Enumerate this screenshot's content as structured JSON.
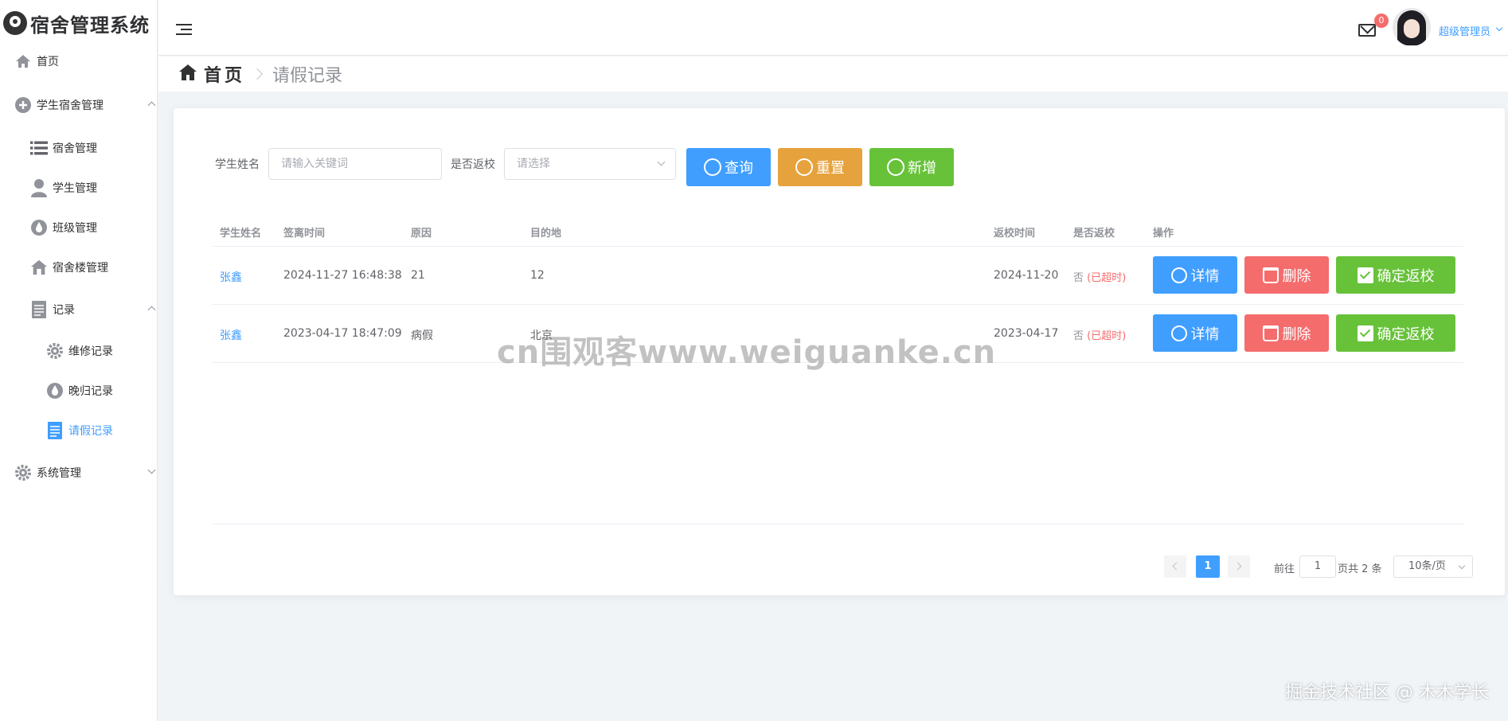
{
  "app": {
    "title": "宿舍管理系统"
  },
  "sidebar": {
    "home": "首页",
    "dorm_group": "学生宿舍管理",
    "dorm": "宿舍管理",
    "student": "学生管理",
    "class": "班级管理",
    "building": "宿舍楼管理",
    "records": "记录",
    "repair": "维修记录",
    "late_return": "晚归记录",
    "leave": "请假记录",
    "system": "系统管理"
  },
  "header": {
    "badge_count": "0",
    "user_name": "超级管理员"
  },
  "breadcrumb": {
    "home": "首页",
    "current": "请假记录"
  },
  "filter": {
    "name_label": "学生姓名",
    "name_placeholder": "请输入关键词",
    "returned_label": "是否返校",
    "returned_placeholder": "请选择",
    "query": "查询",
    "reset": "重置",
    "add": "新增"
  },
  "table": {
    "headers": [
      "学生姓名",
      "签离时间",
      "原因",
      "目的地",
      "返校时间",
      "是否返校",
      "操作"
    ],
    "rows": [
      {
        "name": "张鑫",
        "leave_time": "2024-11-27 16:48:38",
        "reason": "21",
        "destination": "12",
        "return_time": "2024-11-20",
        "returned": "否",
        "overdue": "(已超时)"
      },
      {
        "name": "张鑫",
        "leave_time": "2023-04-17 18:47:09",
        "reason": "病假",
        "destination": "北京",
        "return_time": "2023-04-17",
        "returned": "否",
        "overdue": "(已超时)"
      }
    ],
    "actions": {
      "detail": "详情",
      "delete": "删除",
      "confirm": "确定返校"
    }
  },
  "pagination": {
    "current_page": "1",
    "goto_prefix": "前往",
    "goto_value": "1",
    "goto_suffix": "页共 2 条",
    "page_size": "10条/页"
  },
  "watermarks": {
    "center": "cn围观客www.weiguanke.cn",
    "corner": "掘金技术社区 @ 木木学长"
  },
  "colors": {
    "primary": "#409eff",
    "warning": "#e6a23c",
    "success": "#67c23a",
    "danger": "#f56c6c"
  }
}
